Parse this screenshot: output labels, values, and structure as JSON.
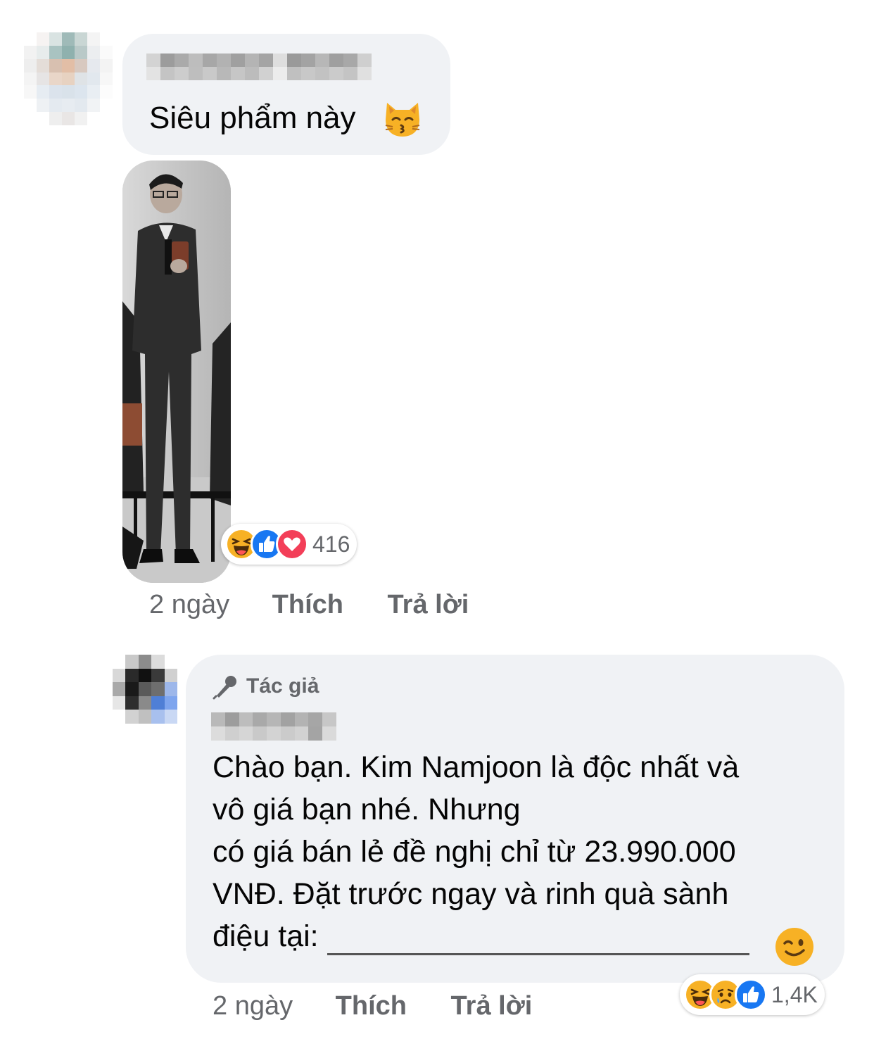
{
  "comment1": {
    "text": "Siêu phẩm này",
    "emoji_icon": "kissing-cat-face",
    "reactions": {
      "icons": [
        "laugh-reaction",
        "like-reaction",
        "love-reaction"
      ],
      "count": "416"
    },
    "time": "2 ngày",
    "like_label": "Thích",
    "reply_label": "Trả lời"
  },
  "comment2": {
    "author_badge": "Tác giả",
    "badge_icon": "microphone-icon",
    "lines": {
      "l1": "Chào bạn. Kim Namjoon là độc nhất và",
      "l2": "vô giá bạn nhé. Nhưng",
      "l3": "có giá bán lẻ đề nghị chỉ từ 23.990.000",
      "l4": "VNĐ. Đặt trước ngay và rinh quà sành",
      "l5": "điệu tại:"
    },
    "emoji_icon": "winking-face",
    "reactions": {
      "icons": [
        "laugh-reaction",
        "sad-reaction",
        "like-reaction"
      ],
      "count": "1,4K"
    },
    "time": "2 ngày",
    "like_label": "Thích",
    "reply_label": "Trả lời"
  },
  "colors": {
    "bubble": "#f0f2f5",
    "meta_text": "#65676b",
    "like_blue": "#1877f2",
    "love_red": "#f33e58",
    "emoji_yellow": "#f7b125"
  }
}
